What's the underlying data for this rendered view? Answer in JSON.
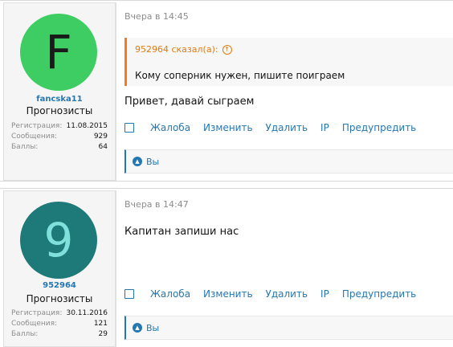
{
  "posts": [
    {
      "user": {
        "avatar_letter": "F",
        "avatar_bg": "#3dcd63",
        "avatar_fg": "#1a1a1a",
        "name": "fancska11",
        "title": "Прогнозисты",
        "stats": [
          {
            "label": "Регистрация:",
            "value": "11.08.2015"
          },
          {
            "label": "Сообщения:",
            "value": "929"
          },
          {
            "label": "Баллы:",
            "value": "64"
          }
        ]
      },
      "date": "Вчера в 14:45",
      "quote": {
        "author": "952964 сказал(а):",
        "icon": "arrow-up-circle-icon",
        "text": "Кому соперник нужен, пишите поиграем"
      },
      "message": "Привет, давай сыграем",
      "actions": [
        "Жалоба",
        "Изменить",
        "Удалить",
        "IP",
        "Предупредить"
      ],
      "likes": "Вы"
    },
    {
      "user": {
        "avatar_letter": "9",
        "avatar_bg": "#1e7a78",
        "avatar_fg": "#7fe0dc",
        "name": "952964",
        "title": "Прогнозисты",
        "stats": [
          {
            "label": "Регистрация:",
            "value": "30.11.2016"
          },
          {
            "label": "Сообщения:",
            "value": "121"
          },
          {
            "label": "Баллы:",
            "value": "29"
          }
        ]
      },
      "date": "Вчера в 14:47",
      "message": "Капитан запиши нас",
      "actions": [
        "Жалоба",
        "Изменить",
        "Удалить",
        "IP",
        "Предупредить"
      ],
      "likes": "Вы"
    }
  ],
  "colors": {
    "link": "#2577b1",
    "quote_accent": "#f87a13"
  }
}
